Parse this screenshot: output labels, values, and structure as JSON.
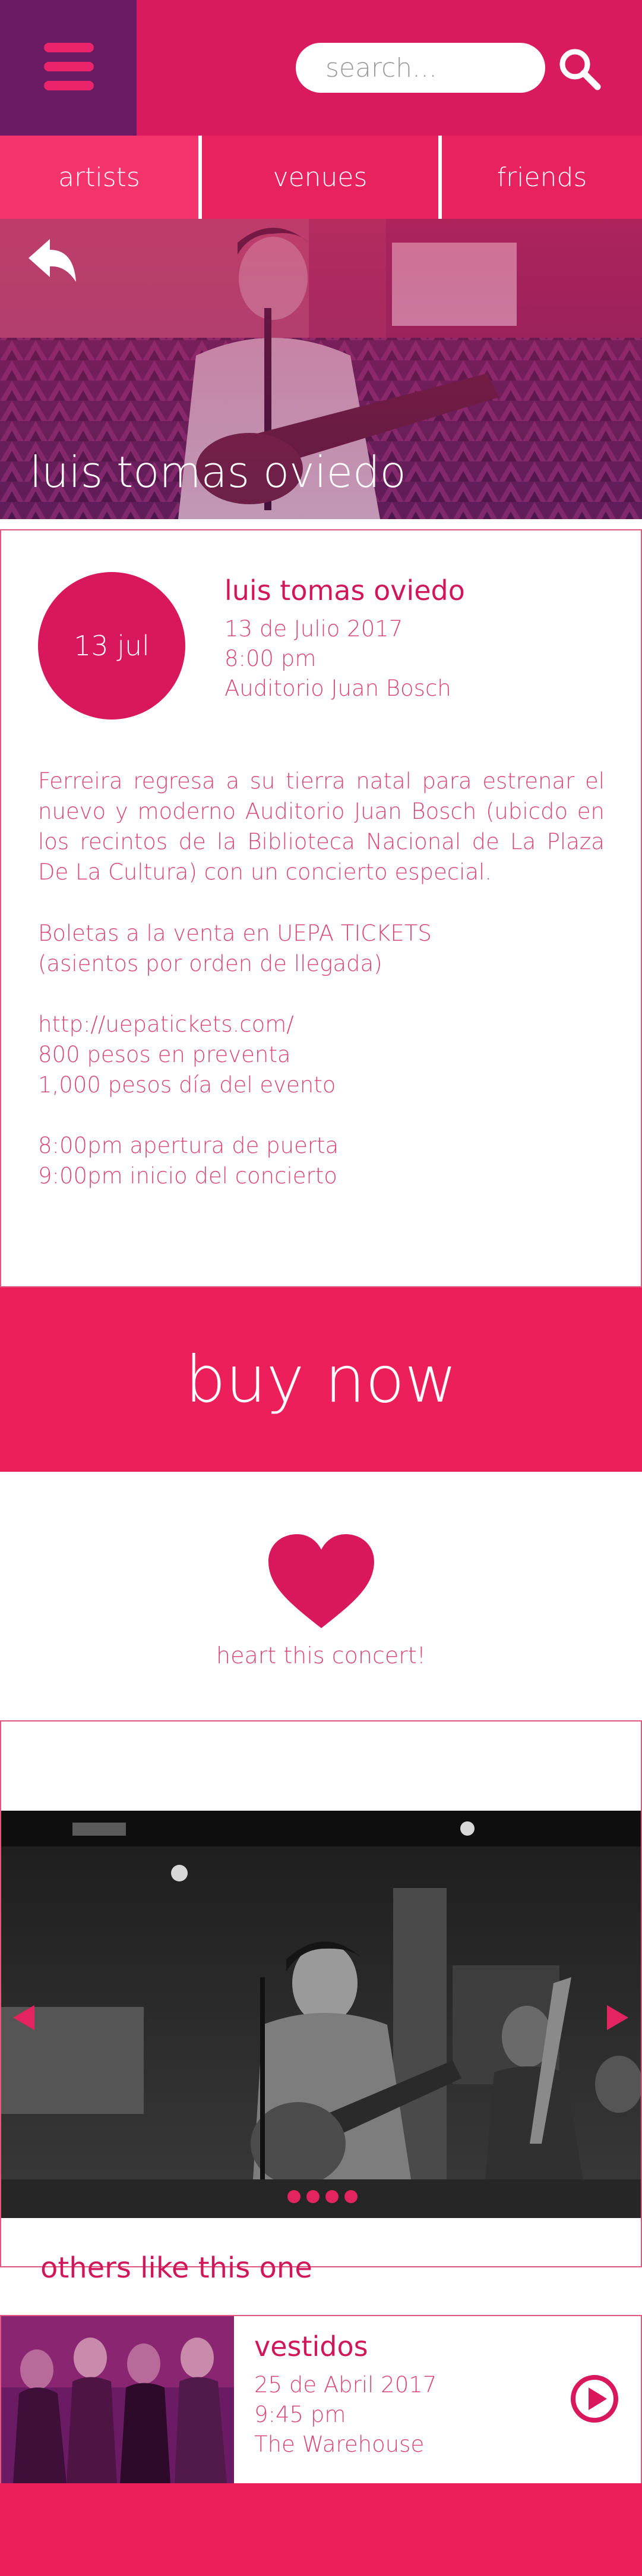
{
  "header": {
    "search_placeholder": "search...",
    "brand_color": "#d91a5e",
    "menu_color": "#6a1b63"
  },
  "tabs": [
    {
      "label": "artists"
    },
    {
      "label": "venues"
    },
    {
      "label": "friends"
    }
  ],
  "hero": {
    "title": "luis tomas oviedo"
  },
  "event": {
    "date_badge": "13 jul",
    "artist": "luis tomas oviedo",
    "date": "13 de Julio 2017",
    "time": "8:00 pm",
    "venue": "Auditorio Juan Bosch",
    "description": "Ferreira regresa a su tierra natal para estrenar el nuevo y moderno Auditorio Juan Bosch (ubicdo en los recintos de la Biblioteca Nacional de La Plaza De La Cultura) con un concierto especial.",
    "tickets_line1": "Boletas a la venta en UEPA TICKETS",
    "tickets_line2": "(asientos por orden de llegada)",
    "link": "http://uepatickets.com/",
    "price_presale": "800 pesos en preventa",
    "price_day": "1,000 pesos día del evento",
    "doors": "8:00pm apertura de puerta",
    "start": "9:00pm inicio del concierto"
  },
  "buy": {
    "label": "buy now",
    "color": "#ec1f5b"
  },
  "heart": {
    "label": "heart this concert!"
  },
  "gallery": {
    "slides": 4
  },
  "others": {
    "title": "others like this one",
    "items": [
      {
        "title": "vestidos",
        "date": "25 de Abril 2017",
        "time": "9:45 pm",
        "venue": "The Warehouse"
      }
    ]
  }
}
